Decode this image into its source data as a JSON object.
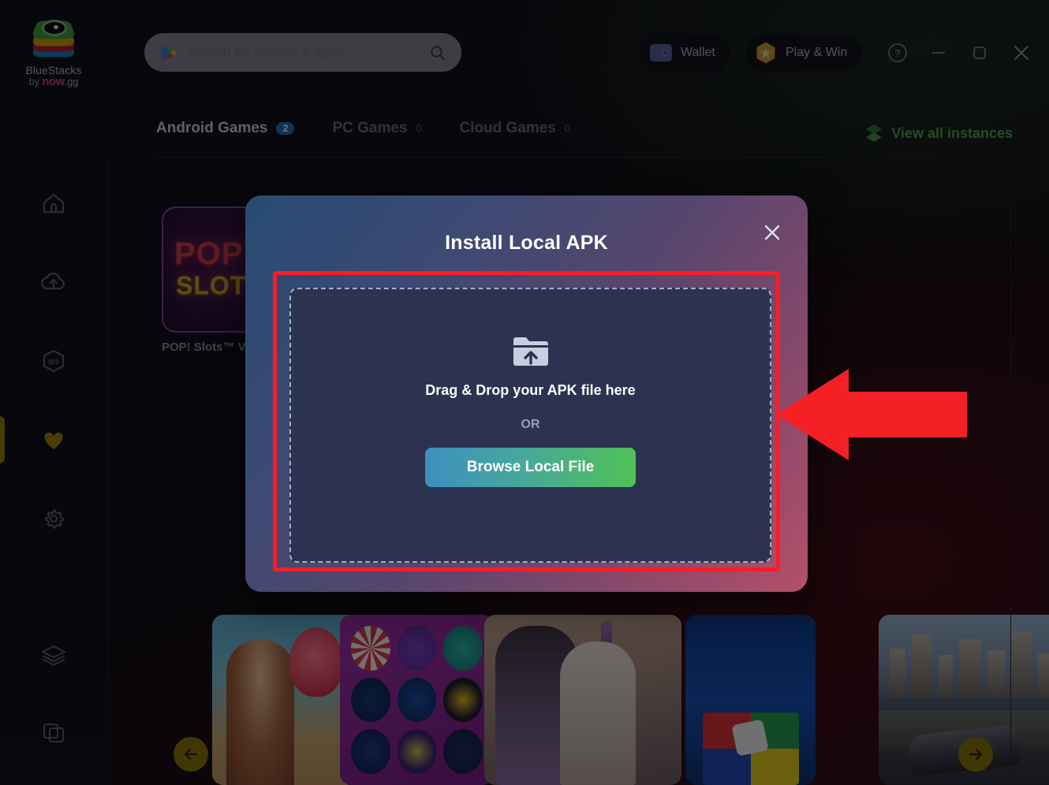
{
  "app": {
    "name": "BlueStacks",
    "logo": {
      "line1": "BlueStacks",
      "by": "by ",
      "brand": "now",
      "tld": ".gg"
    }
  },
  "topbar": {
    "search": {
      "placeholder": "Search for Games & Apps",
      "value": "",
      "icon": "google-play-icon",
      "search_icon": "search-icon"
    },
    "wallet_label": "Wallet",
    "play_win_label": "Play & Win",
    "window_controls": {
      "help": "?",
      "minimize": "—",
      "maximize": "▢",
      "close": "✕"
    }
  },
  "tabs": [
    {
      "label": "Android Games",
      "count": "2",
      "active": true
    },
    {
      "label": "PC Games",
      "count": "0",
      "active": false
    },
    {
      "label": "Cloud Games",
      "count": "0",
      "active": false
    }
  ],
  "view_all_instances": {
    "label": "View all instances",
    "icon": "layers-chevron-icon",
    "color": "#4da447"
  },
  "sidebar": {
    "items": [
      {
        "name": "home",
        "icon": "home-icon",
        "active": false
      },
      {
        "name": "cloud-upload",
        "icon": "cloud-upload-icon",
        "active": false
      },
      {
        "name": "web3",
        "icon": "w3-hexagon-icon",
        "active": false
      },
      {
        "name": "favorites",
        "icon": "heart-icon",
        "active": true,
        "color": "#9a8206"
      },
      {
        "name": "settings",
        "icon": "gear-icon",
        "active": false
      },
      {
        "name": "instances",
        "icon": "layers-icon",
        "active": false
      },
      {
        "name": "multi-instance",
        "icon": "duplicate-icon",
        "active": false
      }
    ]
  },
  "content": {
    "featured_card": {
      "title": "POP! Slots™ V",
      "art_line1": "POP",
      "art_line2": "SLOT"
    },
    "carousel": {
      "prev_label": "←",
      "next_label": "→",
      "cards": [
        {
          "name": "beach-dragon-game"
        },
        {
          "name": "casino-chips-game"
        },
        {
          "name": "mage-staff-game"
        },
        {
          "name": "ludo-board-game"
        },
        {
          "name": "city-racing-game"
        }
      ]
    }
  },
  "modal": {
    "title": "Install Local APK",
    "close_label": "✕",
    "dropzone": {
      "icon": "folder-upload-icon",
      "label": "Drag & Drop your APK file here",
      "or": "OR",
      "browse_label": "Browse Local File"
    },
    "highlight_color": "#fb1d26"
  },
  "annotation": {
    "arrow": "left-pointing-arrow",
    "color": "#f51f26"
  }
}
